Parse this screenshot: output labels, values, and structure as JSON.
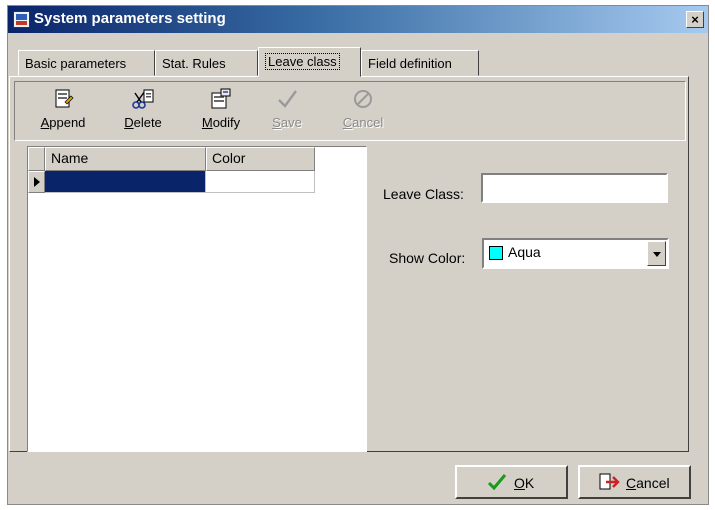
{
  "window": {
    "title": "System parameters setting",
    "close_glyph": "×"
  },
  "tabs": [
    {
      "label": "Basic parameters"
    },
    {
      "label": "Stat. Rules"
    },
    {
      "label": "Leave class"
    },
    {
      "label": "Field definition"
    }
  ],
  "toolbar": {
    "append": {
      "label_u": "A",
      "label_rest": "ppend",
      "icon": "append-icon"
    },
    "delete": {
      "label_u": "D",
      "label_rest": "elete",
      "icon": "delete-icon"
    },
    "modify": {
      "label_u": "M",
      "label_rest": "odify",
      "icon": "modify-icon"
    },
    "save": {
      "label_u": "S",
      "label_rest": "ave",
      "icon": "checkmark-icon",
      "disabled": true
    },
    "cancel": {
      "label_u": "C",
      "label_rest": "ancel",
      "icon": "cancel-icon",
      "disabled": true
    }
  },
  "grid": {
    "columns": [
      "Name",
      "Color"
    ],
    "rows": [
      {
        "name": "",
        "color": ""
      }
    ],
    "selected_color": "#0a246a"
  },
  "form": {
    "leave_class_label": "Leave Class:",
    "leave_class_value": "",
    "show_color_label": "Show Color:",
    "show_color_value": "Aqua",
    "swatch_color": "#00ffff"
  },
  "buttons": {
    "ok": {
      "label_u": "O",
      "label_rest": "K",
      "icon": "checkmark-icon"
    },
    "cancel": {
      "label_u": "C",
      "label_rest": "ancel",
      "icon": "door-exit-icon"
    }
  }
}
